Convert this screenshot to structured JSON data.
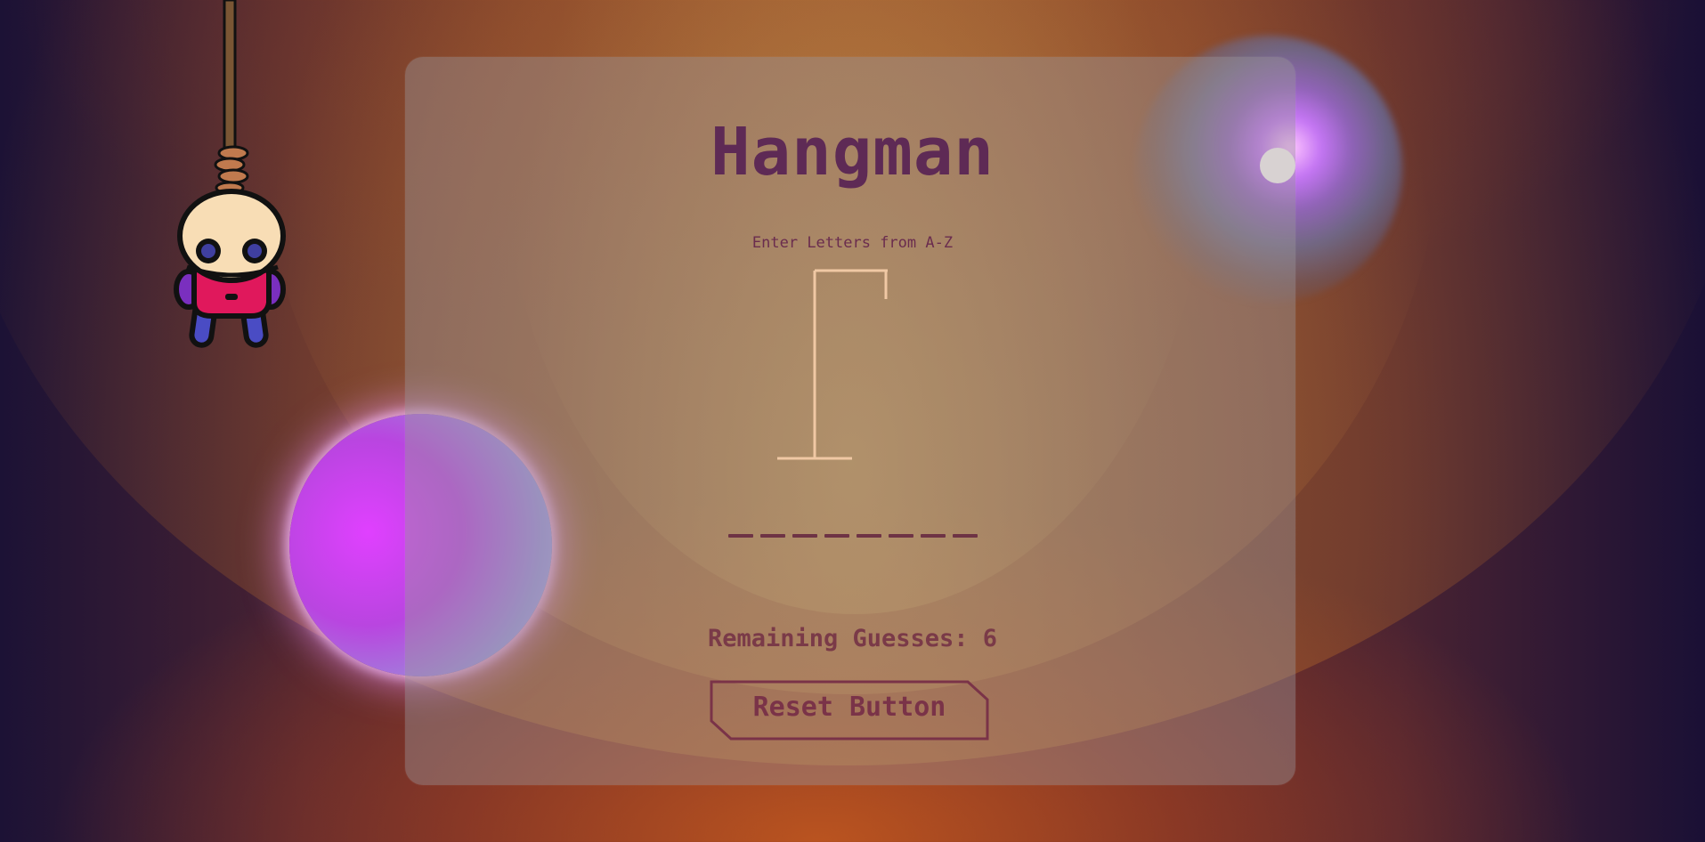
{
  "game": {
    "title": "Hangman",
    "instructions": "Enter Letters from A-Z",
    "word_slot_count": 8,
    "remaining_guesses_text": "Remaining Guesses: 6",
    "remaining_guesses": 6,
    "reset_label": "Reset Button"
  },
  "colors": {
    "title": "#5e2a55",
    "gallows": "#f0c8a4",
    "accent": "#7a3348"
  },
  "icons": {
    "mascot": "hanging-doll-icon",
    "gallows": "gallows-icon"
  }
}
